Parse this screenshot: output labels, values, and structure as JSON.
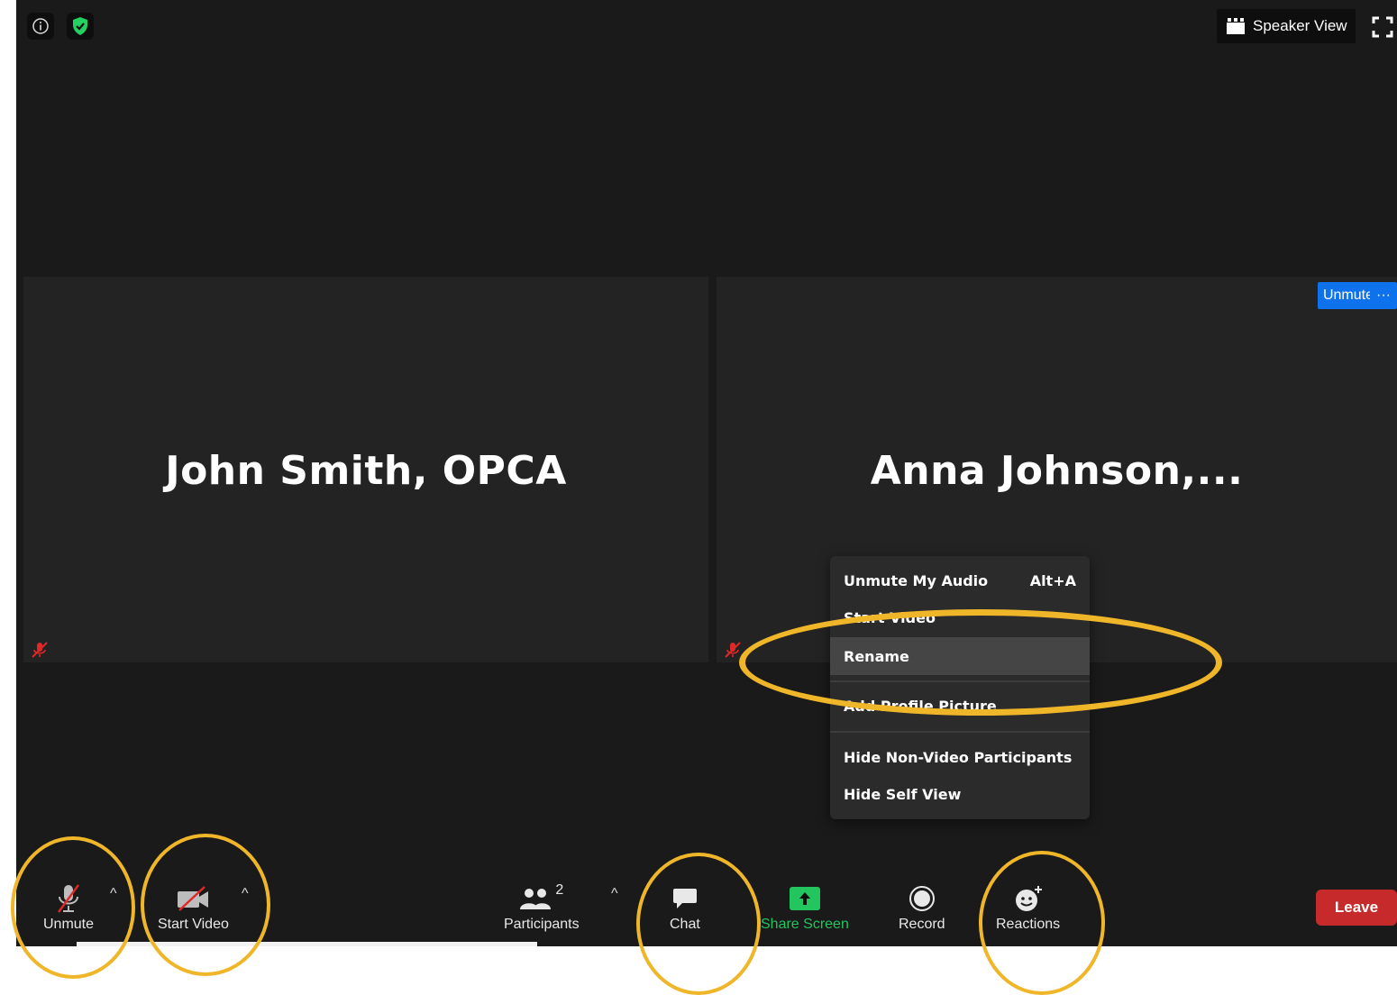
{
  "top_bar": {
    "info_icon": "info-icon",
    "security_icon": "shield-check-icon",
    "speaker_view_label": "Speaker View",
    "fullscreen_icon": "fullscreen-icon"
  },
  "tiles": [
    {
      "name": "John Smith, OPCA",
      "muted": true
    },
    {
      "name": "Anna  Johnson,...",
      "muted": true,
      "unmute_label": "Unmute",
      "more_label": "···"
    }
  ],
  "context_menu": {
    "items": [
      {
        "label": "Unmute My Audio",
        "shortcut": "Alt+A"
      },
      {
        "label": "Start Video"
      },
      {
        "label": "Rename",
        "highlighted": true
      },
      {
        "label": "Add Profile Picture"
      },
      {
        "label": "Hide Non-Video Participants"
      },
      {
        "label": "Hide Self View"
      }
    ]
  },
  "toolbar": {
    "unmute_label": "Unmute",
    "start_video_label": "Start Video",
    "participants_label": "Participants",
    "participants_count": "2",
    "chat_label": "Chat",
    "share_screen_label": "Share Screen",
    "record_label": "Record",
    "reactions_label": "Reactions",
    "leave_label": "Leave",
    "caret": "^"
  },
  "colors": {
    "background": "#1a1a1a",
    "tile": "#232323",
    "accent_blue": "#0e72ed",
    "share_green": "#22c55e",
    "leave_red": "#c62a2a",
    "mute_red": "#e02828",
    "annotation_yellow": "#f0b62a"
  }
}
